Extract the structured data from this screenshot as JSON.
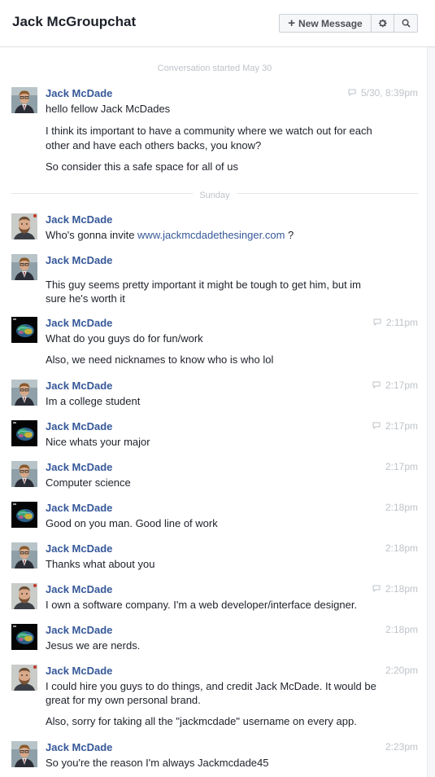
{
  "header": {
    "title": "Jack McGroupchat",
    "new_message_label": "New Message",
    "plus_glyph": "+",
    "gear_icon": "gear-icon",
    "search_icon": "search-icon"
  },
  "dividers": {
    "started": "Conversation started May 30",
    "sunday": "Sunday"
  },
  "messages": [
    {
      "sender": "Jack McDade",
      "time": "5/30, 8:39pm",
      "avatar": "suit",
      "lines": [
        "hello fellow Jack McDades",
        "I think its important to have a community where we watch out for each",
        "other and have each others backs, you know?",
        "So consider this a safe space for all of us"
      ]
    },
    {
      "sender": "Jack McDade",
      "time": "",
      "avatar": "beard",
      "lines": [
        "Who's gonna invite ",
        "www.jackmcdadethesinger.com",
        " ?"
      ]
    },
    {
      "sender": "Jack McDade",
      "time": "",
      "avatar": "suit",
      "lines": [
        "This guy seems pretty important it might be tough to get him, but im",
        "sure he's worth it"
      ]
    },
    {
      "sender": "Jack McDade",
      "time": "2:11pm",
      "avatar": "brain",
      "lines": [
        "What do you guys do for fun/work",
        "Also, we need nicknames to know who is who lol"
      ]
    },
    {
      "sender": "Jack McDade",
      "time": "2:17pm",
      "avatar": "suit",
      "lines": [
        "Im a college student"
      ]
    },
    {
      "sender": "Jack McDade",
      "time": "2:17pm",
      "avatar": "brain",
      "lines": [
        "Nice whats your major"
      ]
    },
    {
      "sender": "Jack McDade",
      "time": "2:17pm",
      "avatar": "suit",
      "lines": [
        "Computer science"
      ]
    },
    {
      "sender": "Jack McDade",
      "time": "2:18pm",
      "avatar": "brain",
      "lines": [
        "Good on you man. Good line of work"
      ]
    },
    {
      "sender": "Jack McDade",
      "time": "2:18pm",
      "avatar": "suit",
      "lines": [
        "Thanks what about you"
      ]
    },
    {
      "sender": "Jack McDade",
      "time": "2:18pm",
      "avatar": "beard",
      "lines": [
        "I own a software company. I'm a web developer/interface designer."
      ]
    },
    {
      "sender": "Jack McDade",
      "time": "2:18pm",
      "avatar": "brain",
      "lines": [
        "Jesus we are nerds."
      ]
    },
    {
      "sender": "Jack McDade",
      "time": "2:20pm",
      "avatar": "beard",
      "lines": [
        "I could hire you guys to do things, and credit Jack McDade. It would be",
        "great for my own personal brand.",
        "Also, sorry for taking all the \"jackmcdade\" username on every app."
      ]
    },
    {
      "sender": "Jack McDade",
      "time": "2:23pm",
      "avatar": "suit",
      "lines": [
        "So you're the reason I'm always Jackmcdade45"
      ]
    }
  ]
}
